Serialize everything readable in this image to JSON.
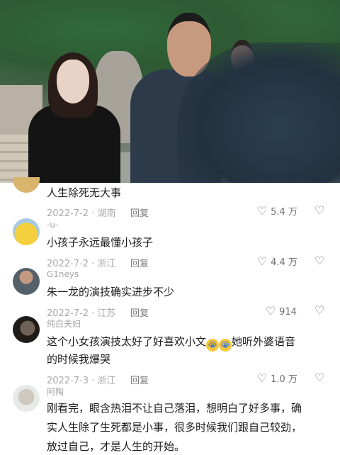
{
  "comments": [
    {
      "text": "人生除死无大事",
      "date": "2022-7-2 · 湖南",
      "reply": "回复",
      "likes": "5.4 万"
    },
    {
      "name": "-u-",
      "text": "小孩子永远最懂小孩子",
      "date": "2022-7-2 · 浙江",
      "reply": "回复",
      "likes": "4.4 万"
    },
    {
      "name": "G1neys",
      "text": "朱一龙的演技确实进步不少",
      "date": "2022-7-2 · 江苏",
      "reply": "回复",
      "likes": "914"
    },
    {
      "name": "纯白夫妇",
      "text_a": "这个小女孩演技太好了好喜欢小文",
      "text_b": "她听外婆语音",
      "text_c": "的时候我爆哭",
      "date": "2022-7-3 · 浙江",
      "reply": "回复",
      "likes": "1.0 万"
    },
    {
      "name": "阿陶",
      "lines": [
        "刚看完，眼含热泪不让自己落泪，想明白了好多事，确",
        "实人生除了生死都是小事，很多时候我们跟自己较劲，",
        "放过自己，才是人生的开始。"
      ]
    }
  ],
  "icons": {
    "like": "heart-outline-icon",
    "dislike": "broken-heart-icon",
    "emoji": "crying-face-emoji"
  },
  "colors": {
    "text": "#1b1b1b",
    "meta": "#a9a9a9",
    "background": "#ffffff"
  }
}
